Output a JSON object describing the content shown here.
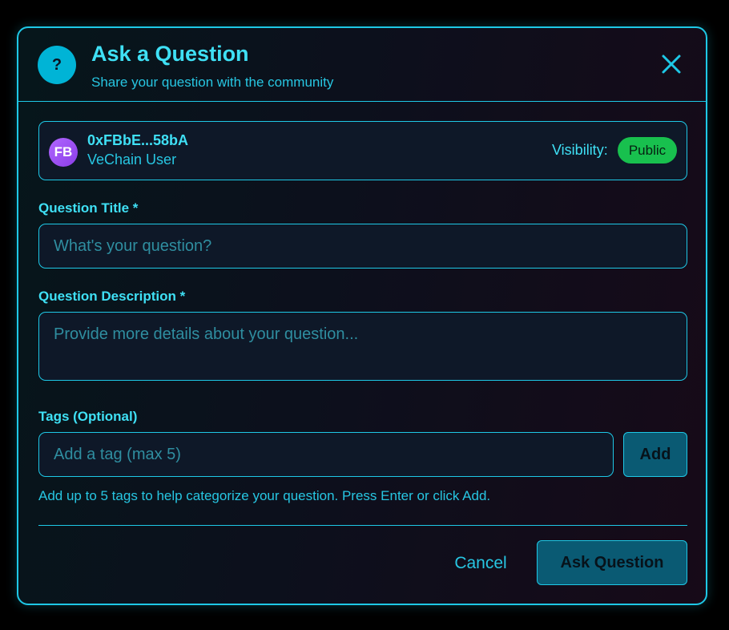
{
  "dialog": {
    "icon": "question-icon",
    "icon_glyph": "?",
    "title": "Ask a Question",
    "subtitle": "Share your question with the community",
    "close_icon": "close-icon"
  },
  "user": {
    "initials": "FB",
    "address": "0xFBbE...58bA",
    "role": "VeChain User",
    "visibility_label": "Visibility:",
    "visibility_value": "Public"
  },
  "form": {
    "title_label": "Question Title *",
    "title_value": "",
    "title_placeholder": "What's your question?",
    "description_label": "Question Description *",
    "description_value": "",
    "description_placeholder": "Provide more details about your question...",
    "tags_label": "Tags (Optional)",
    "tags_value": "",
    "tags_placeholder": "Add a tag (max 5)",
    "add_button": "Add",
    "tags_hint": "Add up to 5 tags to help categorize your question. Press Enter or click Add."
  },
  "actions": {
    "cancel": "Cancel",
    "submit": "Ask Question"
  },
  "colors": {
    "accent": "#1ec8e6",
    "text_accent": "#3fe0f5",
    "badge_public": "#18c04e",
    "avatar": "#a855f7",
    "button_bg": "#0a5a73",
    "background": "#000000"
  }
}
